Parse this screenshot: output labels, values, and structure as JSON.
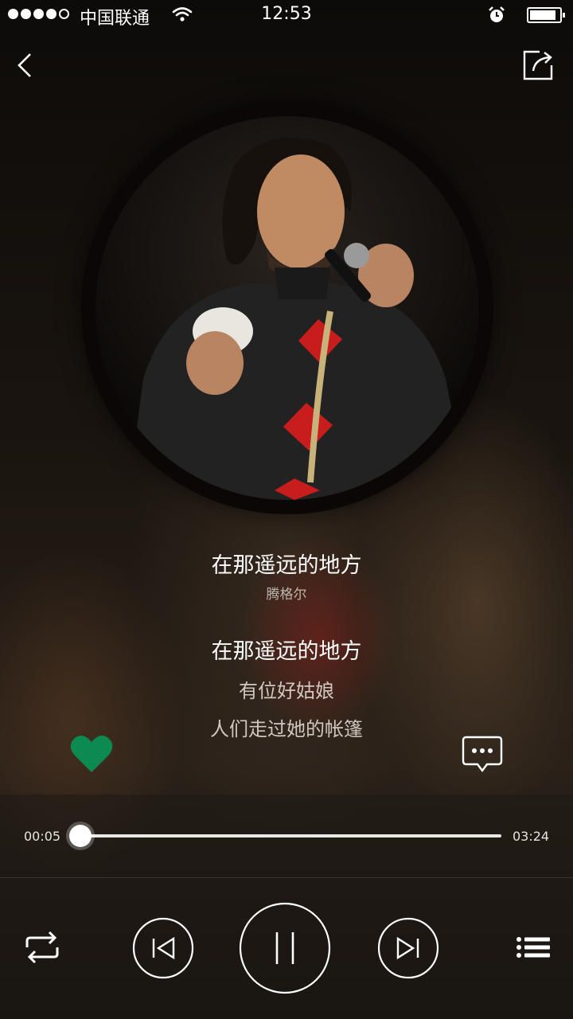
{
  "status_bar": {
    "signal_bars_filled": 4,
    "signal_bars_total": 5,
    "carrier": "中国联通",
    "time": "12:53",
    "icons": [
      "wifi-icon",
      "alarm-icon",
      "battery-icon"
    ],
    "battery_level": 0.9
  },
  "header": {
    "back_icon": "chevron-left-icon",
    "share_icon": "share-icon"
  },
  "now_playing": {
    "title": "在那遥远的地方",
    "artist": "腾格尔",
    "cover_icon": "album-cover"
  },
  "lyrics": {
    "current": "在那遥远的地方",
    "next": [
      "有位好姑娘",
      "人们走过她的帐篷"
    ]
  },
  "actions": {
    "like_icon": "heart-icon",
    "liked": true,
    "comment_icon": "comment-icon"
  },
  "progress": {
    "elapsed": "00:05",
    "total": "03:24",
    "fraction": 0.0245
  },
  "controls": {
    "repeat_icon": "repeat-icon",
    "prev_icon": "previous-icon",
    "play_state": "playing",
    "pause_icon": "pause-icon",
    "next_icon": "next-icon",
    "playlist_icon": "playlist-icon"
  },
  "colors": {
    "accent": "#0d7a4a",
    "heart": "#0c8a52",
    "text": "#ffffff",
    "subtext": "#bdb6ae"
  }
}
